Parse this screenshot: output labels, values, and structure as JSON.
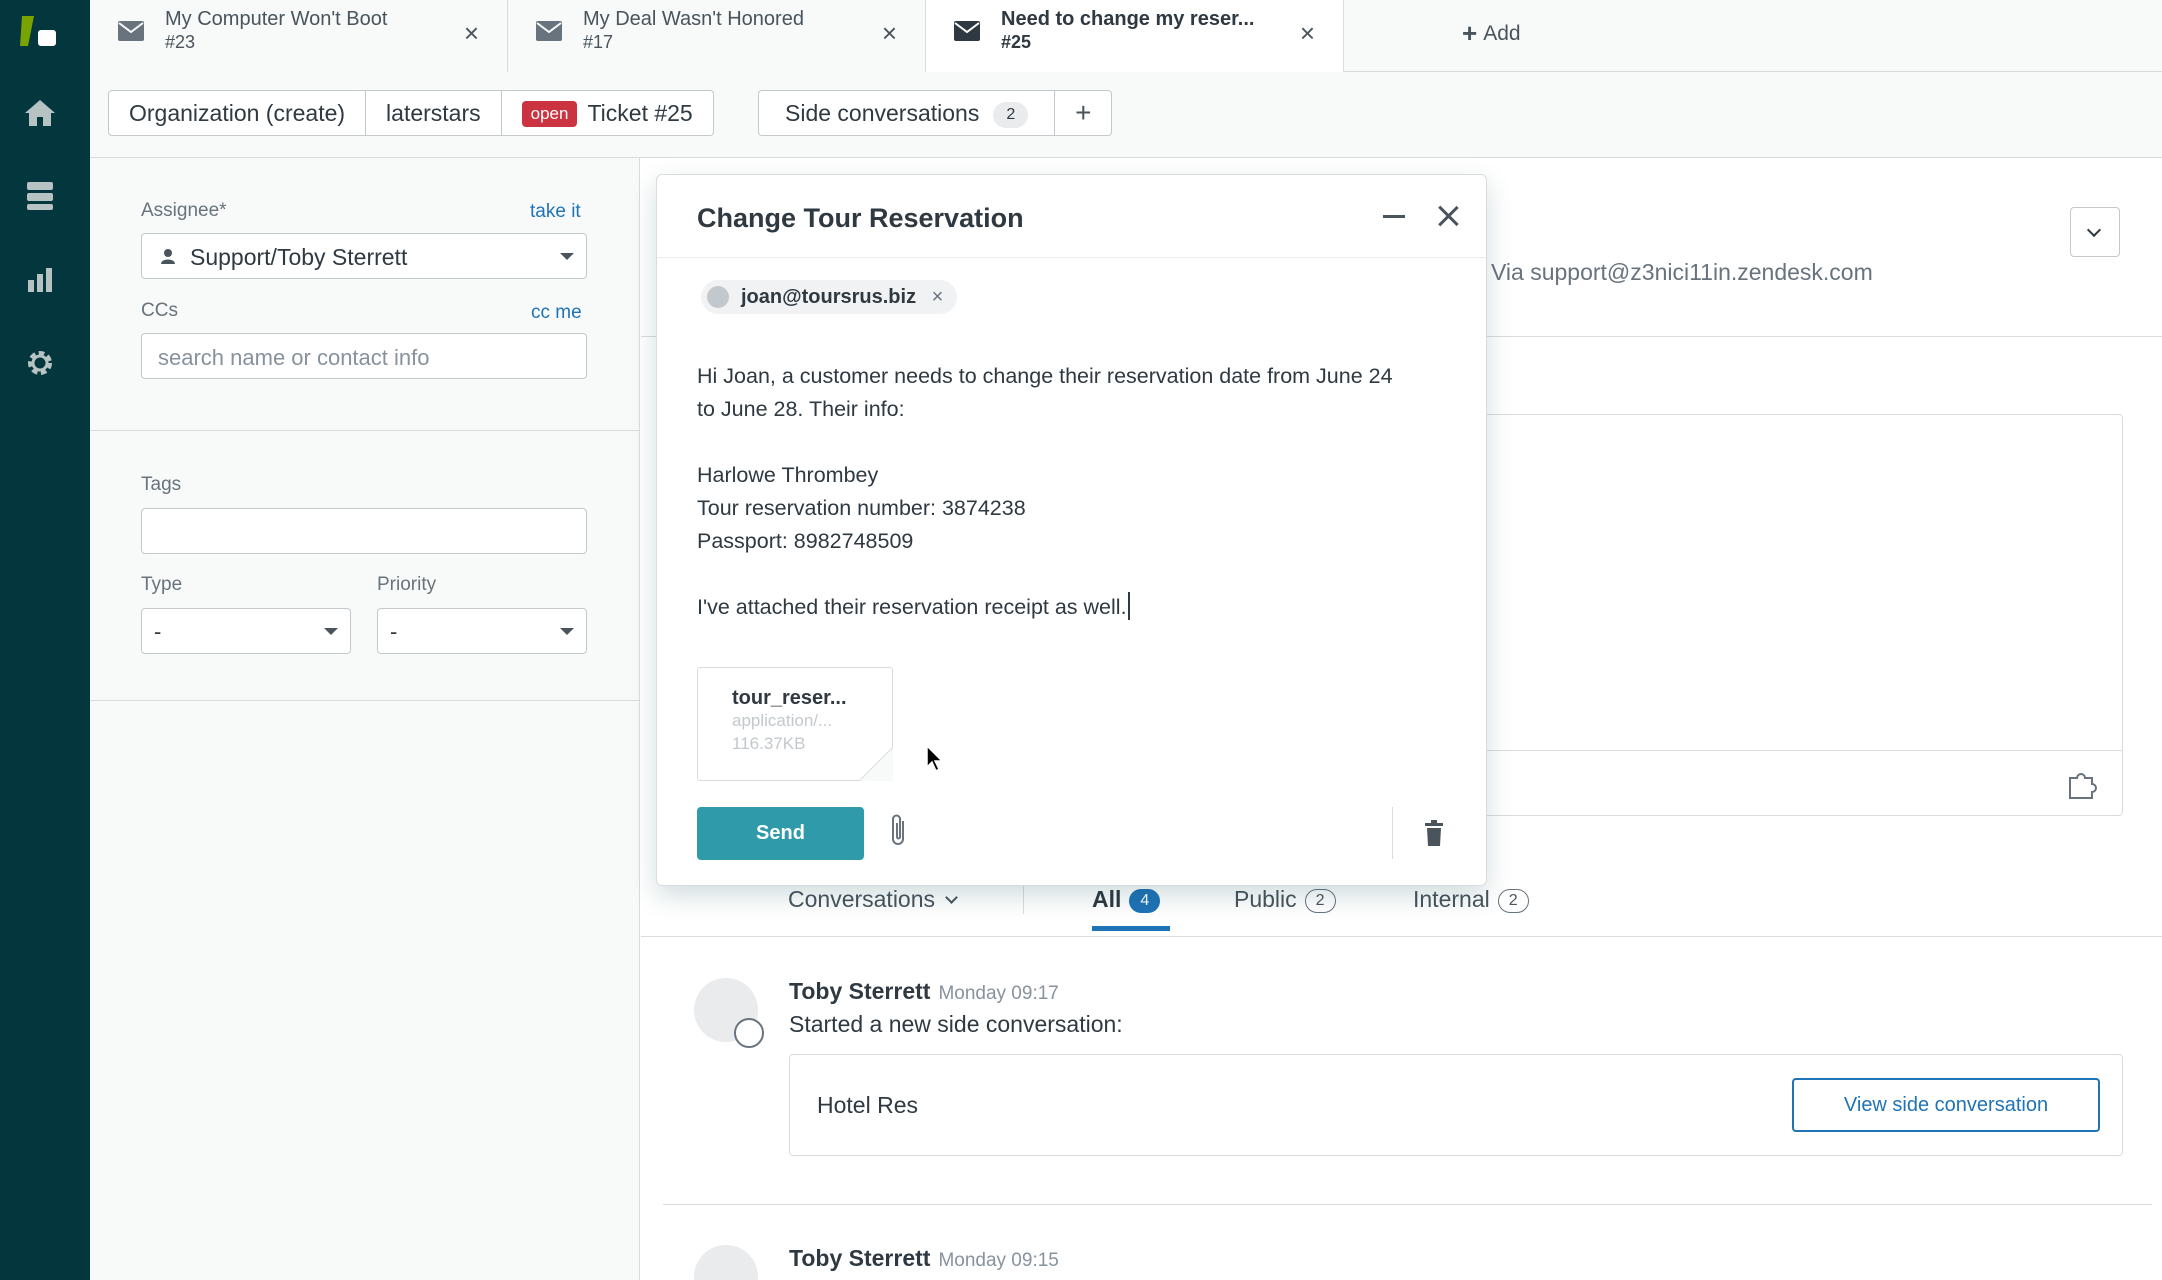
{
  "nav": {
    "icons": [
      "zendesk-logo",
      "home-icon",
      "views-icon",
      "reporting-icon",
      "admin-gear-icon"
    ]
  },
  "tabs": [
    {
      "title": "My Computer Won't Boot",
      "number": "#23"
    },
    {
      "title": "My Deal Wasn't Honored",
      "number": "#17"
    },
    {
      "title": "Need to change my reser...",
      "number": "#25"
    }
  ],
  "add_tab_label": "Add",
  "breadcrumb": {
    "organization": "Organization (create)",
    "requester": "laterstars",
    "status_badge": "open",
    "ticket": "Ticket #25"
  },
  "side_conversations": {
    "label": "Side conversations",
    "count": "2",
    "add": "+"
  },
  "properties": {
    "assignee_label": "Assignee*",
    "take_it": "take it",
    "assignee_value": "Support/Toby Sterrett",
    "ccs_label": "CCs",
    "cc_me": "cc me",
    "ccs_placeholder": "search name or contact info",
    "tags_label": "Tags",
    "type_label": "Type",
    "type_value": "-",
    "priority_label": "Priority",
    "priority_value": "-"
  },
  "ticket": {
    "via": "Via support@z3nici11in.zendesk.com"
  },
  "side_conversation_modal": {
    "title": "Change Tour Reservation",
    "recipient": "joan@toursrus.biz",
    "remove": "×",
    "body_lines": [
      "Hi Joan, a customer needs to change their reservation date from June 24",
      "to June 28. Their info:",
      "",
      "Harlowe Thrombey",
      "Tour reservation number: 3874238",
      "Passport: 8982748509",
      "",
      "I've attached their reservation receipt as well."
    ],
    "attachment": {
      "name": "tour_reser...",
      "type": "application/...",
      "size": "116.37KB"
    },
    "send_label": "Send"
  },
  "conversation_filters": {
    "dropdown_label": "Conversations",
    "all_label": "All",
    "all_count": "4",
    "public_label": "Public",
    "public_count": "2",
    "internal_label": "Internal",
    "internal_count": "2"
  },
  "events": [
    {
      "author": "Toby Sterrett",
      "time": "Monday 09:17",
      "text": "Started a new side conversation:",
      "card_title": "Hotel Res",
      "card_button": "View side conversation"
    },
    {
      "author": "Toby Sterrett",
      "time": "Monday 09:15"
    }
  ],
  "colors": {
    "rail": "#03363d",
    "accent_blue": "#1f73b7",
    "send_button": "#2f9aa9",
    "open_badge": "#cc3340"
  }
}
